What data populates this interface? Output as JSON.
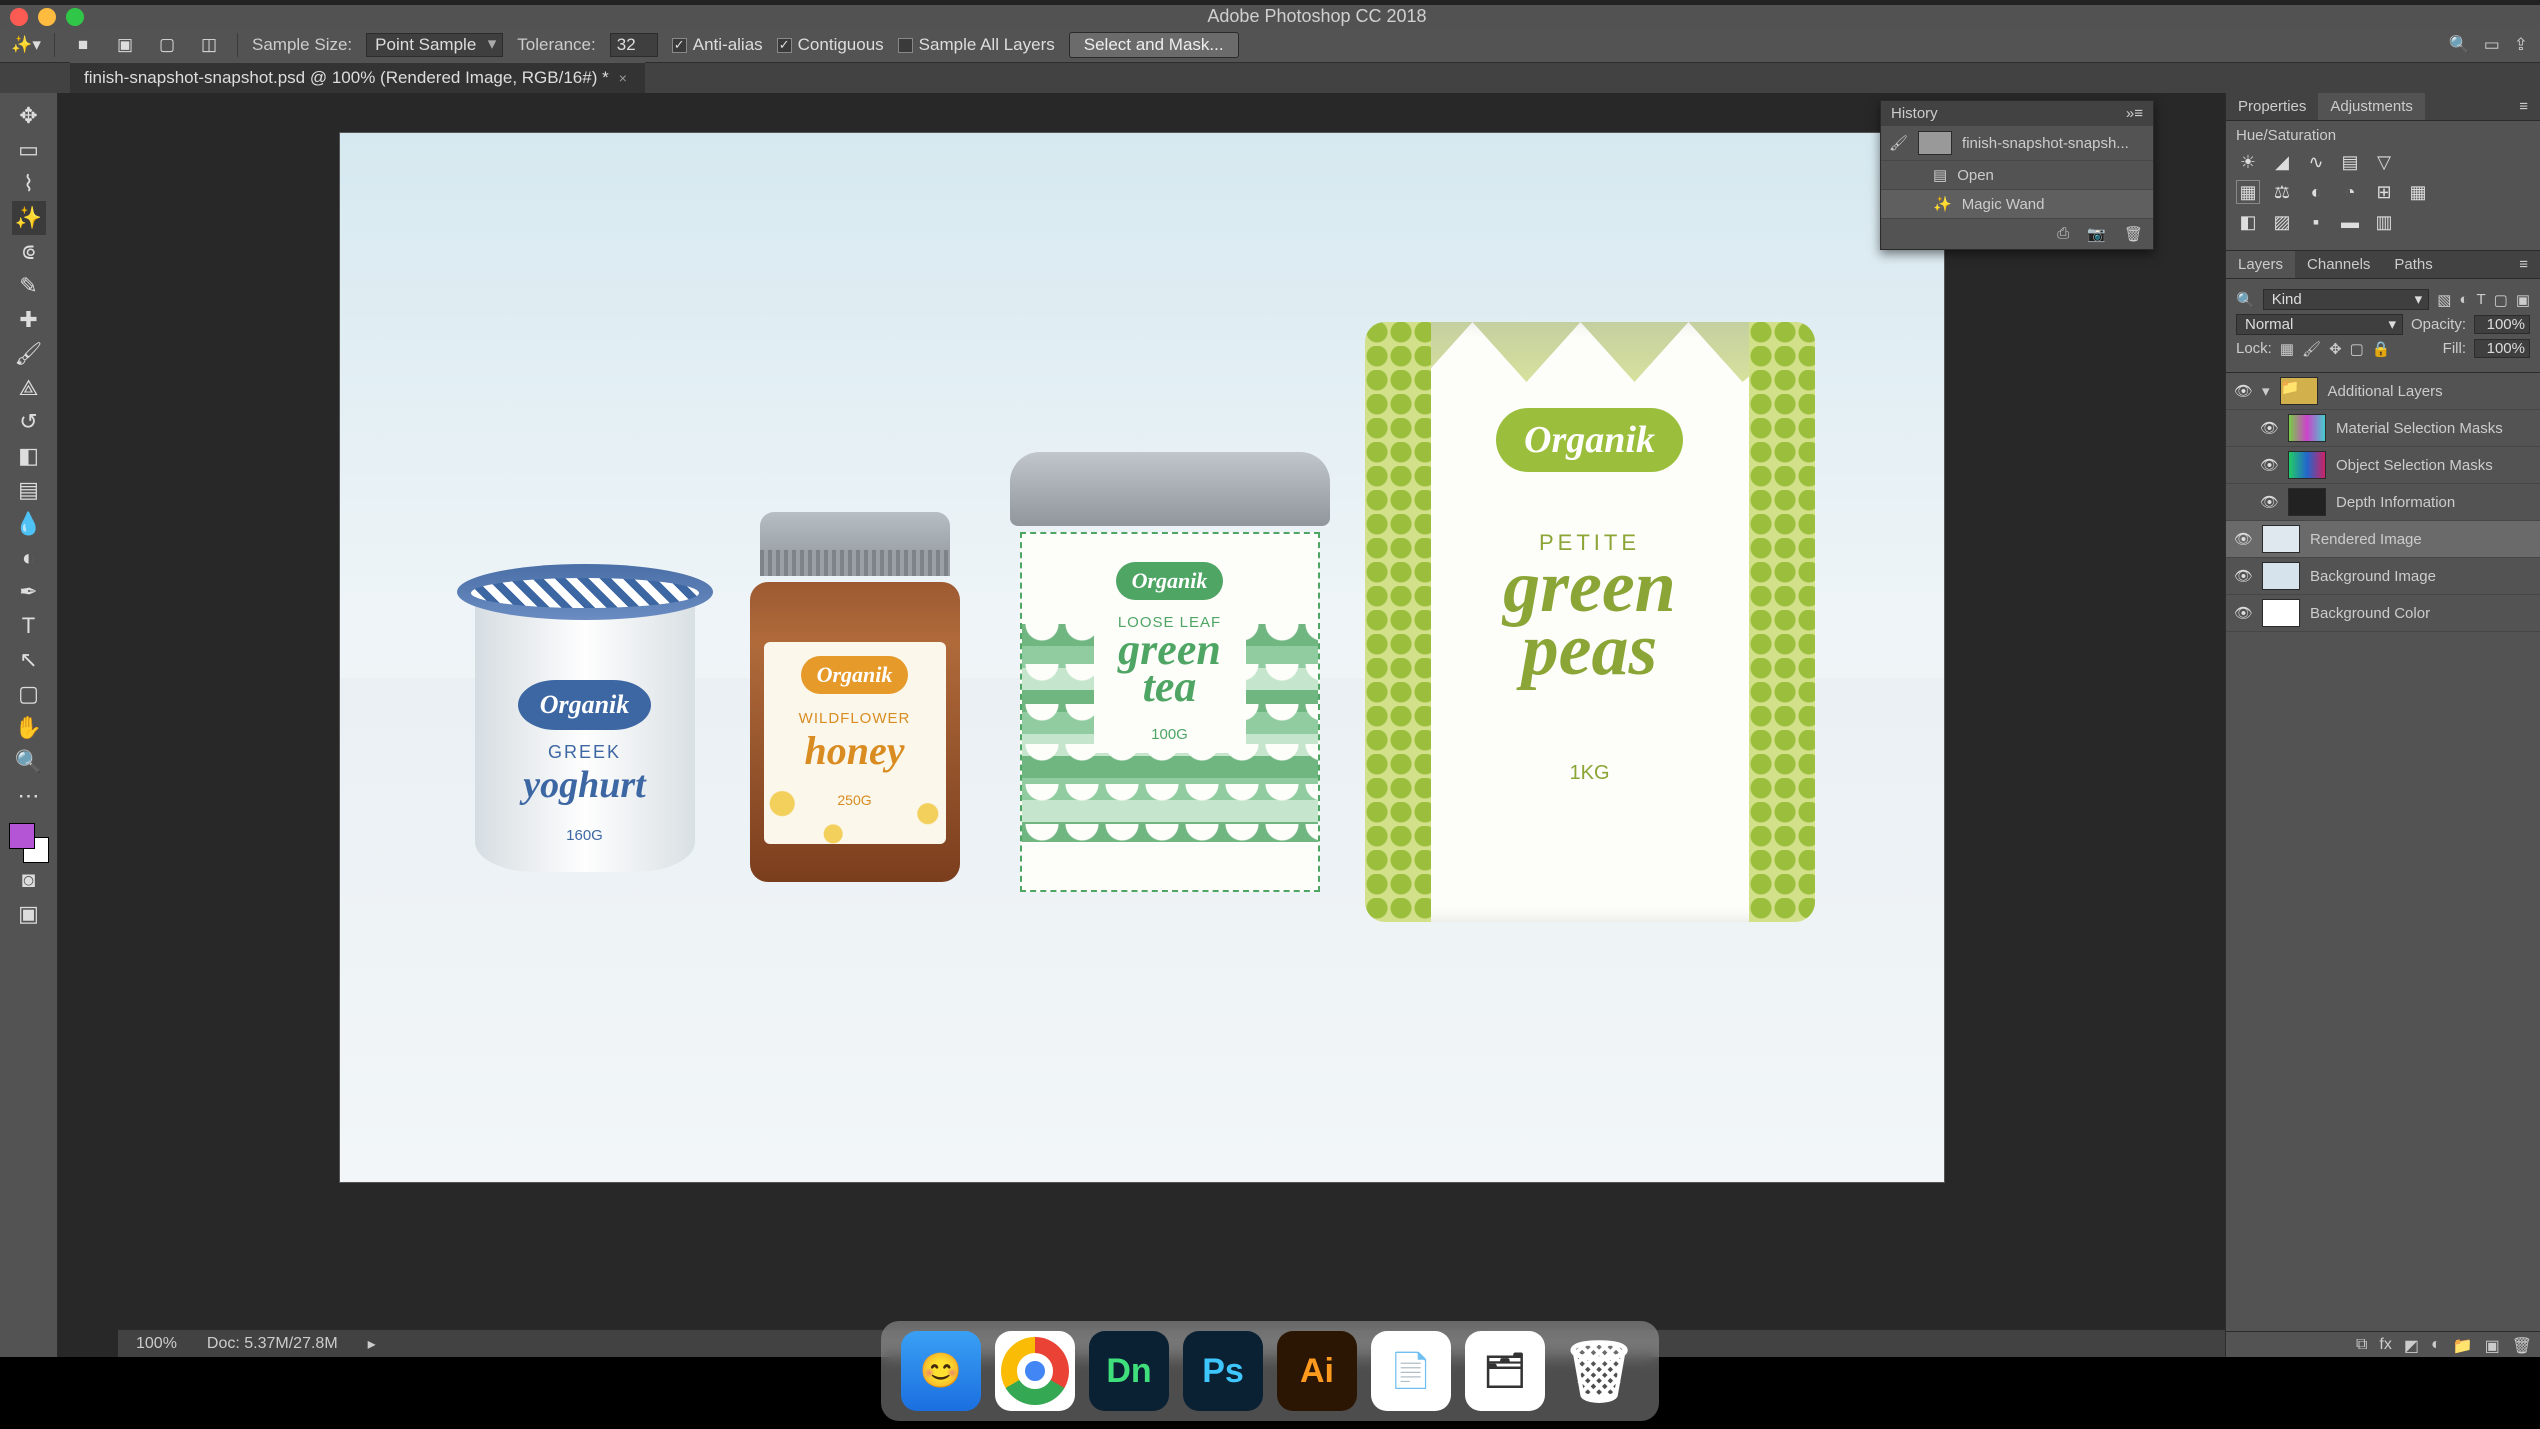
{
  "app_title": "Adobe Photoshop CC 2018",
  "options": {
    "sample_size_label": "Sample Size:",
    "sample_size_value": "Point Sample",
    "tolerance_label": "Tolerance:",
    "tolerance_value": "32",
    "antialias_label": "Anti-alias",
    "antialias_checked": true,
    "contiguous_label": "Contiguous",
    "contiguous_checked": true,
    "sample_all_label": "Sample All Layers",
    "sample_all_checked": false,
    "select_mask_label": "Select and Mask..."
  },
  "document_tab": "finish-snapshot-snapshot.psd @ 100% (Rendered Image, RGB/16#) *",
  "history_panel": {
    "title": "History",
    "snapshot": "finish-snapshot-snapsh...",
    "items": [
      "Open",
      "Magic Wand"
    ]
  },
  "right_panels": {
    "prop_tabs": [
      "Properties",
      "Adjustments"
    ],
    "adjust_heading": "Hue/Saturation",
    "layer_tabs": [
      "Layers",
      "Channels",
      "Paths"
    ],
    "filter_label": "Kind",
    "blend_mode": "Normal",
    "opacity_label": "Opacity:",
    "opacity_value": "100%",
    "lock_label": "Lock:",
    "fill_label": "Fill:",
    "fill_value": "100%",
    "layers": [
      {
        "name": "Additional Layers",
        "group": true
      },
      {
        "name": "Material Selection Masks"
      },
      {
        "name": "Object Selection Masks"
      },
      {
        "name": "Depth Information"
      },
      {
        "name": "Rendered Image",
        "selected": true
      },
      {
        "name": "Background Image"
      },
      {
        "name": "Background Color"
      }
    ]
  },
  "status": {
    "zoom": "100%",
    "docinfo": "Doc: 5.37M/27.8M"
  },
  "products": {
    "brand": "Organik",
    "yogurt": {
      "line1": "GREEK",
      "line2": "yoghurt",
      "weight": "160G"
    },
    "honey": {
      "line1": "WILDFLOWER",
      "line2": "honey",
      "weight": "250G"
    },
    "tea": {
      "line1": "LOOSE LEAF",
      "line2a": "green",
      "line2b": "tea",
      "weight": "100G"
    },
    "peas": {
      "line1": "PETITE",
      "line2a": "green",
      "line2b": "peas",
      "weight": "1KG"
    }
  },
  "dock": {
    "dn": "Dn",
    "ps": "Ps",
    "ai": "Ai"
  }
}
